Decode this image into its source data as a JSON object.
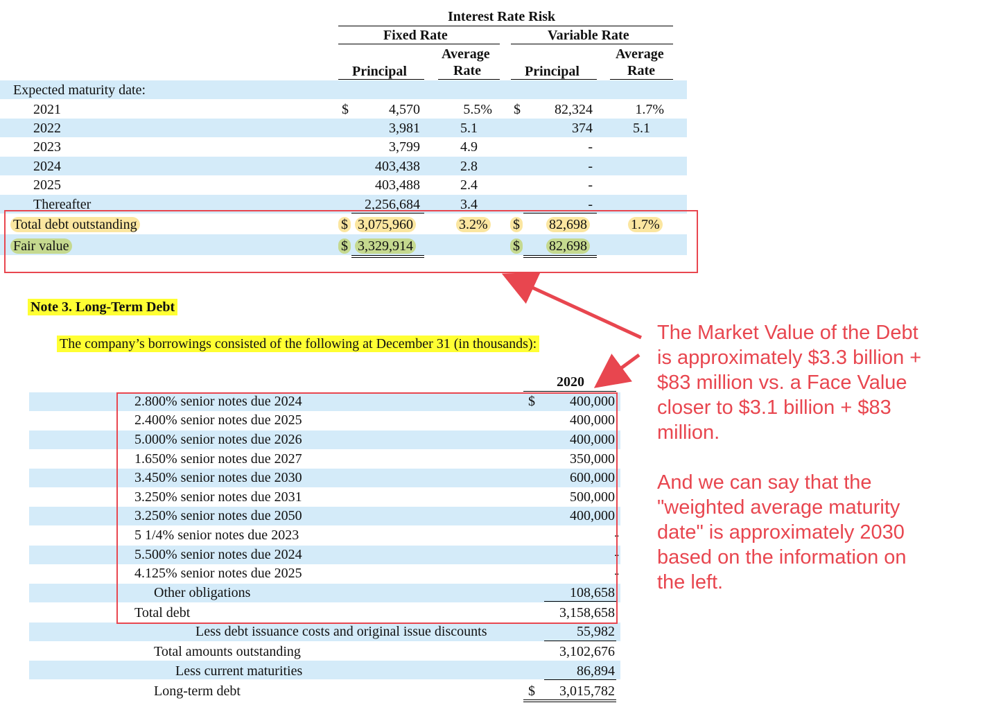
{
  "top_table": {
    "title": "Interest Rate Risk",
    "fixed_header": "Fixed Rate",
    "variable_header": "Variable Rate",
    "principal_label": "Principal",
    "average_label": "Average",
    "rate_label": "Rate",
    "section_label": "Expected maturity date:",
    "currency": "$",
    "rows": [
      {
        "year": "2021",
        "fixed_principal": "4,570",
        "fixed_rate": "5.5%",
        "variable_principal": "82,324",
        "variable_rate": "1.7%"
      },
      {
        "year": "2022",
        "fixed_principal": "3,981",
        "fixed_rate": "5.1",
        "variable_principal": "374",
        "variable_rate": "5.1"
      },
      {
        "year": "2023",
        "fixed_principal": "3,799",
        "fixed_rate": "4.9",
        "variable_principal": "-",
        "variable_rate": ""
      },
      {
        "year": "2024",
        "fixed_principal": "403,438",
        "fixed_rate": "2.8",
        "variable_principal": "-",
        "variable_rate": ""
      },
      {
        "year": "2025",
        "fixed_principal": "403,488",
        "fixed_rate": "2.4",
        "variable_principal": "-",
        "variable_rate": ""
      },
      {
        "year": "Thereafter",
        "fixed_principal": "2,256,684",
        "fixed_rate": "3.4",
        "variable_principal": "-",
        "variable_rate": ""
      }
    ],
    "total": {
      "label": "Total debt outstanding",
      "fixed_principal": "3,075,960",
      "fixed_rate": "3.2%",
      "variable_principal": "82,698",
      "variable_rate": "1.7%"
    },
    "fair_value": {
      "label": "Fair value",
      "fixed_principal": "3,329,914",
      "variable_principal": "82,698"
    }
  },
  "note3": {
    "heading": "Note 3. Long-Term Debt",
    "intro": "The company’s borrowings consisted of the following at December 31 (in thousands):",
    "year_header": "2020",
    "currency": "$",
    "rows": [
      {
        "label": "2.800% senior notes due 2024",
        "value": "400,000"
      },
      {
        "label": "2.400% senior notes due 2025",
        "value": "400,000"
      },
      {
        "label": "5.000% senior notes due 2026",
        "value": "400,000"
      },
      {
        "label": "1.650% senior notes due 2027",
        "value": "350,000"
      },
      {
        "label": "3.450% senior notes due 2030",
        "value": "600,000"
      },
      {
        "label": "3.250% senior notes due 2031",
        "value": "500,000"
      },
      {
        "label": "3.250% senior notes due 2050",
        "value": "400,000"
      },
      {
        "label": "5 1/4% senior notes due 2023",
        "value": "-"
      },
      {
        "label": "5.500% senior notes due 2024",
        "value": "-"
      },
      {
        "label": "4.125% senior notes due 2025",
        "value": "-"
      },
      {
        "label": "Other obligations",
        "value": "108,658"
      },
      {
        "label": "Total debt",
        "value": "3,158,658"
      },
      {
        "label": "Less debt issuance costs and original issue discounts",
        "value": "55,982"
      },
      {
        "label": "Total amounts outstanding",
        "value": "3,102,676"
      },
      {
        "label": "Less current maturities",
        "value": "86,894"
      },
      {
        "label": "Long-term debt",
        "value": "3,015,782"
      }
    ]
  },
  "annotation": {
    "paragraph1": [
      "The Market Value of the Debt",
      "is approximately $3.3 billion +",
      "$83 million vs. a Face Value",
      "closer to $3.1 billion + $83",
      "million."
    ],
    "paragraph2": [
      "And we can say that the",
      "\"weighted average maturity",
      "date\" is approximately 2030",
      "based on the information on",
      "the left."
    ],
    "color": "#e8464f"
  }
}
